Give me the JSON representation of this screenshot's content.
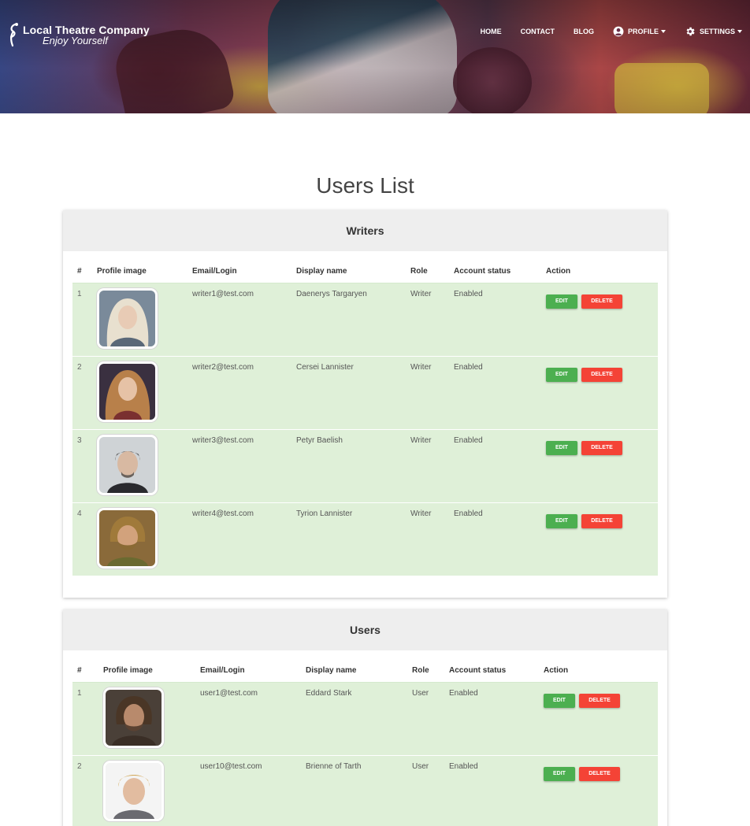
{
  "brand": {
    "name": "Local Theatre Company",
    "tagline": "Enjoy Yourself"
  },
  "nav": {
    "home": "HOME",
    "contact": "CONTACT",
    "blog": "BLOG",
    "profile": "PROFILE",
    "settings": "SETTINGS"
  },
  "page": {
    "title": "Users List"
  },
  "columns": {
    "num": "#",
    "image": "Profile image",
    "email": "Email/Login",
    "display": "Display name",
    "role": "Role",
    "status": "Account status",
    "action": "Action"
  },
  "buttons": {
    "edit": "EDIT",
    "delete": "DELETE"
  },
  "writers": {
    "title": "Writers",
    "rows": [
      {
        "num": "1",
        "email": "writer1@test.com",
        "display": "Daenerys Targaryen",
        "role": "Writer",
        "status": "Enabled"
      },
      {
        "num": "2",
        "email": "writer2@test.com",
        "display": "Cersei Lannister",
        "role": "Writer",
        "status": "Enabled"
      },
      {
        "num": "3",
        "email": "writer3@test.com",
        "display": "Petyr Baelish",
        "role": "Writer",
        "status": "Enabled"
      },
      {
        "num": "4",
        "email": "writer4@test.com",
        "display": "Tyrion Lannister",
        "role": "Writer",
        "status": "Enabled"
      }
    ]
  },
  "users": {
    "title": "Users",
    "rows": [
      {
        "num": "1",
        "email": "user1@test.com",
        "display": "Eddard Stark",
        "role": "User",
        "status": "Enabled"
      },
      {
        "num": "2",
        "email": "user10@test.com",
        "display": "Brienne of Tarth",
        "role": "User",
        "status": "Enabled"
      }
    ]
  },
  "colors": {
    "row_success": "#dff0d8",
    "header_bg": "#eeeeee",
    "edit_button": "#4caf50",
    "delete_button": "#f44336"
  }
}
